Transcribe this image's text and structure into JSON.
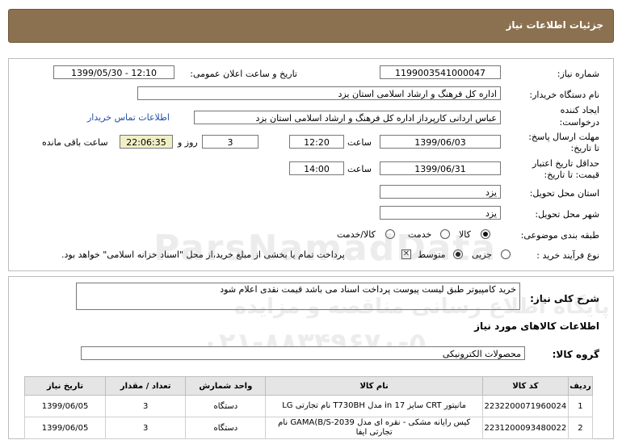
{
  "header": {
    "title": "جزئیات اطلاعات نیاز"
  },
  "fields": {
    "need_number_label": "شماره نیاز:",
    "need_number": "1199003541000047",
    "announce_label": "تاریخ و ساعت اعلان عمومی:",
    "announce_value": "1399/05/30 - 12:10",
    "buyer_label": "نام دستگاه خریدار:",
    "buyer_value": "اداره کل فرهنگ و ارشاد اسلامی استان یزد",
    "creator_label_1": "ایجاد کننده",
    "creator_label_2": "درخواست:",
    "creator_value": "عباس اردانی کارپرداز اداره کل فرهنگ و ارشاد اسلامی استان یزد",
    "contact_link": "اطلاعات تماس خریدار",
    "reply_label_1": "مهلت ارسال پاسخ:",
    "reply_label_2": "تا تاریخ:",
    "reply_date": "1399/06/03",
    "time_label": "ساعت",
    "reply_time": "12:20",
    "days_value": "3",
    "days_label": "روز و",
    "remaining_time": "22:06:35",
    "remaining_label": "ساعت باقی مانده",
    "validity_label_1": "حداقل تاریخ اعتبار",
    "validity_label_2": "قیمت: تا تاریخ:",
    "validity_date": "1399/06/31",
    "validity_time": "14:00",
    "province_label": "استان محل تحویل:",
    "province_value": "یزد",
    "city_label": "شهر محل تحویل:",
    "city_value": "یزد",
    "category_label": "طبقه بندی موضوعی:",
    "category_options": [
      "کالا",
      "خدمت",
      "کالا/خدمت"
    ],
    "process_label": "نوع فرآیند خرید :",
    "process_options": [
      "جزیی",
      "متوسط"
    ],
    "payment_note": "پرداخت تمام یا بخشی از مبلغ خرید،از محل \"اسناد خزانه اسلامی\" خواهد بود."
  },
  "description": {
    "label": "شرح کلی نیاز:",
    "text": "خرید کامپیوتر طبق لیست پیوست پرداخت اسناد می باشد قیمت نقدی اعلام شود"
  },
  "goods": {
    "section_title": "اطلاعات کالاهای مورد نیاز",
    "group_label": "گروه کالا:",
    "group_value": "محصولات الکترونیکی"
  },
  "watermark": {
    "line1": "ParsNamadData",
    "line2": "پایگاه اطلاع رسانی مناقصه و مزایده",
    "line3": "۰۲۱-۸۸۳۴۹۶۷۰-۵"
  },
  "table": {
    "headers": [
      "ردیف",
      "کد کالا",
      "نام کالا",
      "واحد شمارش",
      "تعداد / مقدار",
      "تاریخ نیاز"
    ],
    "rows": [
      {
        "row": "1",
        "code": "2232200071960024",
        "name": "مانیتور CRT سایز 17 in مدل T730BH نام تجارتی LG",
        "unit": "دستگاه",
        "qty": "3",
        "date": "1399/06/05"
      },
      {
        "row": "2",
        "code": "2231200093480022",
        "name": "کیس رایانه مشکی - نقره ای مدل GAMA(B/S-2039 نام تجارتی ایفا",
        "unit": "دستگاه",
        "qty": "3",
        "date": "1399/06/05"
      }
    ]
  }
}
